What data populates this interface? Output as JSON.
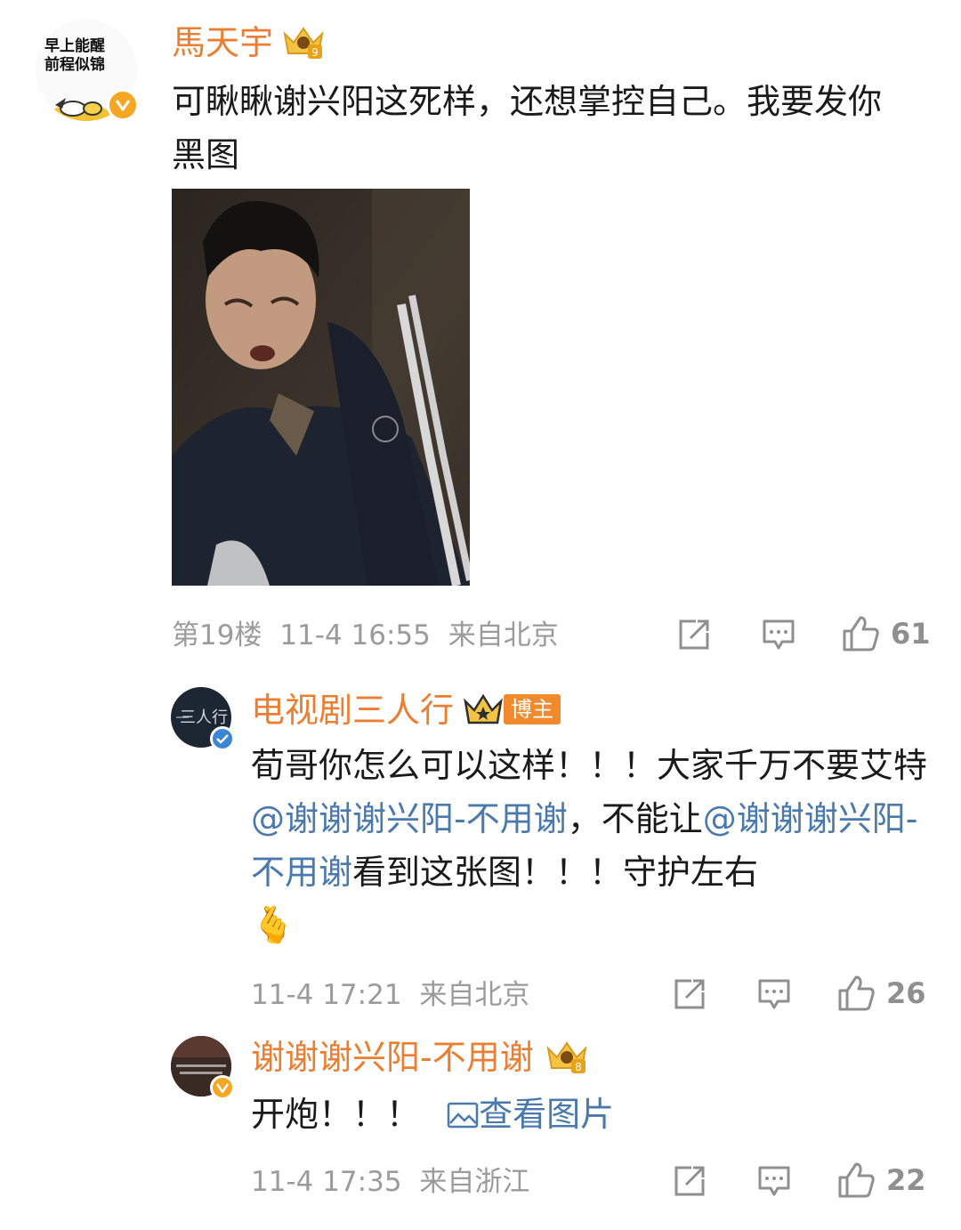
{
  "comments": [
    {
      "avatar_text_line1": "早上能醒",
      "avatar_text_line2": "前程似锦",
      "username": "馬天宇",
      "crown_level": "9",
      "text": "可瞅瞅谢兴阳这死样，还想掌控自己。我要发你黑图",
      "floor": "第19楼",
      "time": "11-4 16:55",
      "location": "来自北京",
      "likes": "61"
    },
    {
      "username": "电视剧三人行",
      "author_badge": "博主",
      "text_part1": "荀哥你怎么可以这样！！！大家千万不要艾特",
      "mention1": "@谢谢谢兴阳-不用谢",
      "text_part2": "，不能让",
      "mention2": "@谢谢谢兴阳-不用谢",
      "text_part3": "看到这张图！！！守护左右",
      "emoji": "🫰",
      "time": "11-4 17:21",
      "location": "来自北京",
      "likes": "26"
    },
    {
      "username": "谢谢谢兴阳-不用谢",
      "crown_level": "8",
      "text": "开炮！！！",
      "view_image_label": "查看图片",
      "time": "11-4 17:35",
      "location": "来自浙江",
      "likes": "22"
    }
  ],
  "colors": {
    "username": "#eb7e30",
    "mention": "#4a79ae",
    "meta": "#9b9b9b",
    "badge_bg": "#f08a2c",
    "verified_orange": "#f5a623",
    "verified_blue": "#3a86d4"
  },
  "icons": {
    "share": "share-icon",
    "comment": "comment-icon",
    "like": "thumbs-up-icon",
    "image": "image-icon",
    "crown": "crown-icon"
  }
}
